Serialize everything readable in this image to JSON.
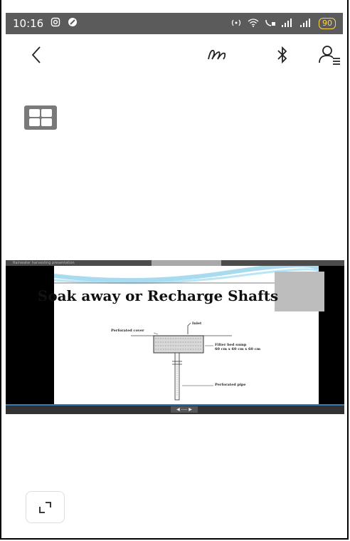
{
  "status_bar": {
    "time": "10:16",
    "battery": "90",
    "signal_glyphs": "……"
  },
  "toolbar": {
    "back_icon": "chevron-left-icon",
    "draw_icon": "scribble-icon",
    "bluetooth_icon": "bluetooth-icon",
    "user_icon": "user-list-icon"
  },
  "slide": {
    "header_text": "Rainwater harvesting presentation",
    "title": "Soak away or Recharge Shafts",
    "labels": {
      "inlet": "Inlet",
      "perforated_cover": "Perforated cover",
      "filter_bed": "Filter bed sump",
      "dimensions": "60 cm x 60 cm x 60 cm",
      "perforated_pipe": "Perforated pipe"
    },
    "nav": "◀ ---- ▶"
  },
  "colors": {
    "status_bar": "#5b5b5b",
    "accent_blue": "#3a78b5",
    "grid_button": "#7a7a7a"
  }
}
